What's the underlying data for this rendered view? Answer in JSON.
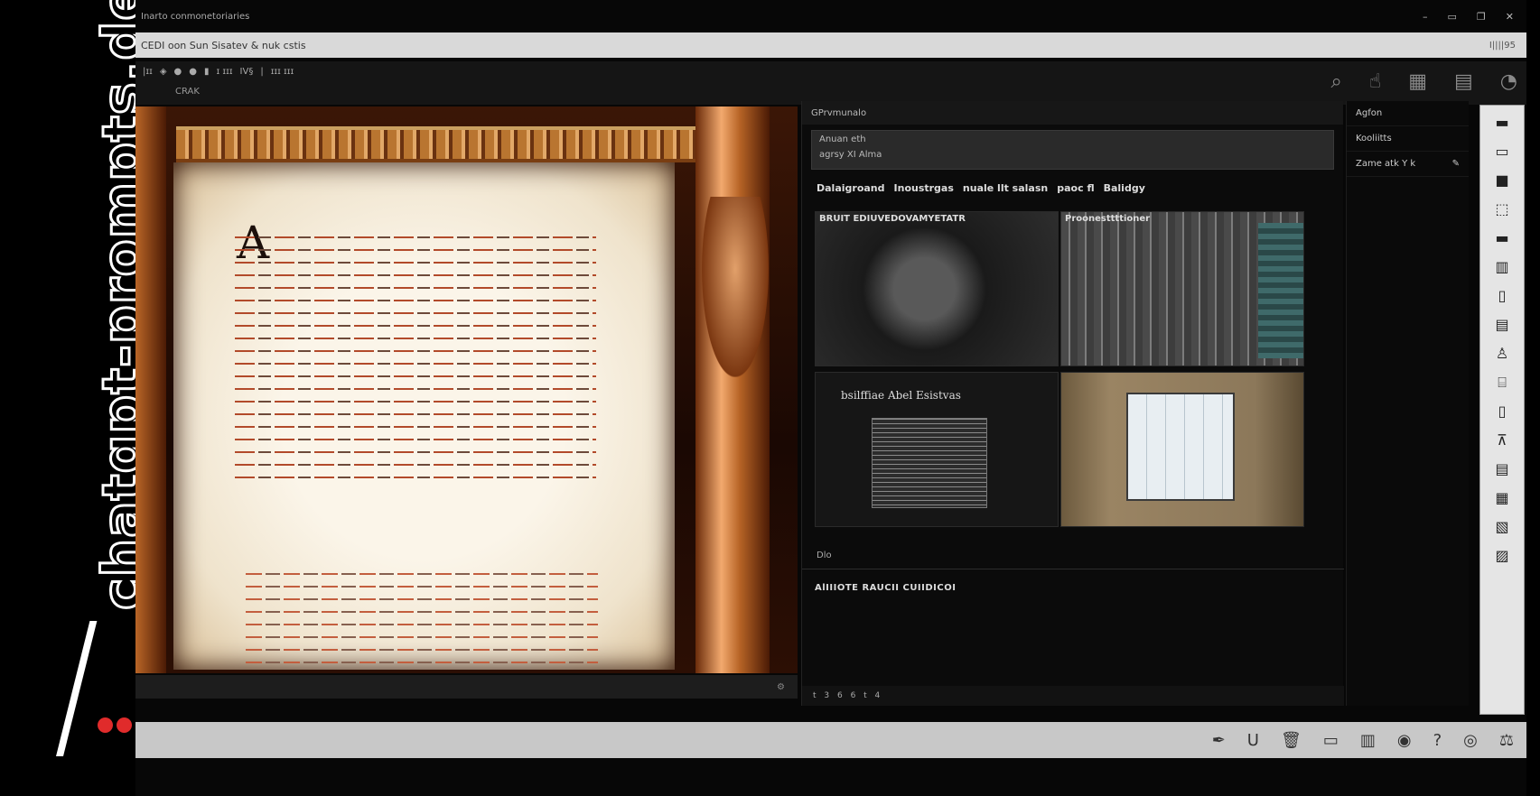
{
  "watermark": {
    "text": "chatgpt-prompts.de"
  },
  "window": {
    "title": "Inarto conmonetoriaries",
    "controls": [
      "–",
      "▭",
      "❐",
      "✕"
    ]
  },
  "address": {
    "text": "CEDI oon Sun Sisatev & nuk cstis",
    "right": "I||||95"
  },
  "toolbar": {
    "items": [
      "|ɪɪ",
      "◈",
      "●",
      "●",
      "▮",
      "ɪ ɪɪɪ",
      "IV§",
      "|",
      "ɪɪɪ ɪɪɪ"
    ],
    "sub_label": "CRAK",
    "right_icons": [
      "search-icon",
      "hand-icon",
      "grid-icon",
      "document-icon",
      "circle-icon"
    ]
  },
  "results_panel": {
    "header": "GPrvmunalo",
    "input_line1": "Anuan eth",
    "input_line2": "agrsy XI Alma",
    "tabs": [
      "Dalaigroand",
      "Inoustrgas",
      "nuale llt salasn",
      "paoc fl",
      "Balidgy"
    ],
    "thumbnails": [
      {
        "label": "BRUIT EDIUVEDOVAMYETATR",
        "caption": "",
        "kind": "scan"
      },
      {
        "label": "Proonesttttioner",
        "caption": "",
        "kind": "interface"
      },
      {
        "label": "",
        "caption": "bsilffiae Abel Esistvas",
        "kind": "document"
      },
      {
        "label": "",
        "caption": "",
        "kind": "screen"
      }
    ],
    "status": "Dlo",
    "section": "AlIIIOTE RAUCII CUIIDICOI",
    "footer": "t 3 6 6 t 4"
  },
  "side_panel": {
    "items": [
      {
        "label": "Agfon",
        "icon": "arrow-icon"
      },
      {
        "label": "Kooliitts",
        "icon": ""
      },
      {
        "label": "Zame atk Y k",
        "icon": "pencil-icon"
      }
    ]
  },
  "palette": {
    "tools": [
      "▬",
      "▭",
      "■",
      "⬚",
      "▬",
      "▥",
      "▯",
      "▤",
      "♙",
      "⌸",
      "▯",
      "⊼",
      "▤",
      "▦",
      "▧",
      "▨"
    ]
  },
  "bottombar": {
    "tools": [
      "pen-icon",
      "underline-icon",
      "trash-icon",
      "window-icon",
      "panels-icon",
      "eye-icon",
      "help-icon",
      "record-icon",
      "scale-icon"
    ]
  },
  "colors": {
    "accent_red": "#e02b2b",
    "parchment": "#f5ecd9",
    "gold": "#e2a868"
  }
}
